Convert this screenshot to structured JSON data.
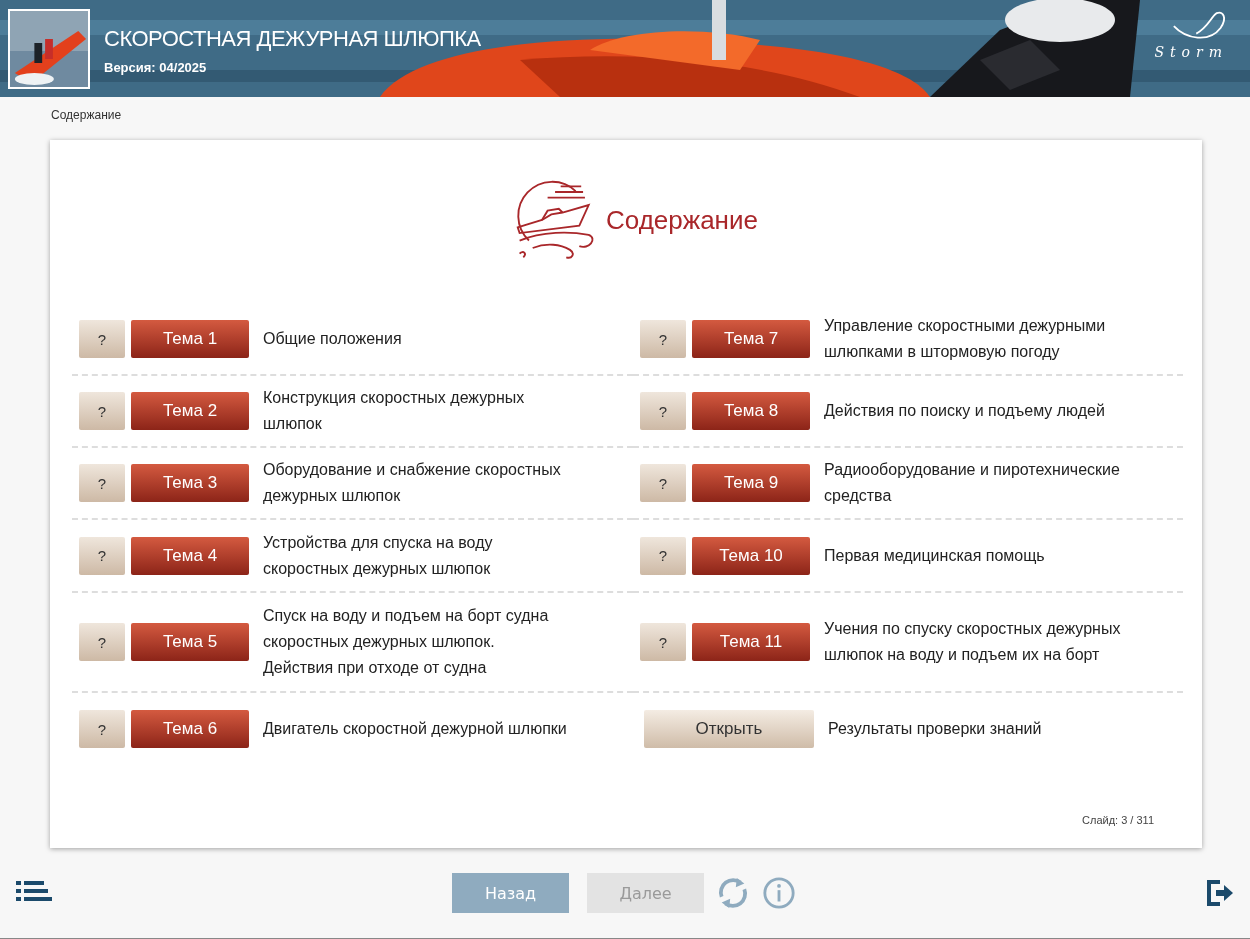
{
  "header": {
    "title": "СКОРОСТНАЯ ДЕЖУРНАЯ ШЛЮПКА",
    "version": "Версия: 04/2025",
    "logo_text": "Storm"
  },
  "breadcrumb": "Содержание",
  "content": {
    "heading": "Содержание",
    "items": [
      {
        "kind": "topic",
        "help": "?",
        "button": "Тема 1",
        "title": "Общие положения"
      },
      {
        "kind": "topic",
        "help": "?",
        "button": "Тема 2",
        "title": "Конструкция скоростных дежурных\nшлюпок"
      },
      {
        "kind": "topic",
        "help": "?",
        "button": "Тема 3",
        "title": "Оборудование и снабжение скоростных\nдежурных шлюпок"
      },
      {
        "kind": "topic",
        "help": "?",
        "button": "Тема 4",
        "title": "Устройства для спуска на воду\nскоростных дежурных шлюпок"
      },
      {
        "kind": "topic",
        "help": "?",
        "button": "Тема 5",
        "title": "Спуск на воду и подъем на борт судна\nскоростных дежурных шлюпок.\nДействия при отходе от судна"
      },
      {
        "kind": "topic",
        "help": "?",
        "button": "Тема 6",
        "title": "Двигатель скоростной дежурной шлюпки"
      },
      {
        "kind": "topic",
        "help": "?",
        "button": "Тема 7",
        "title": "Управление скоростными дежурными\nшлюпками в штормовую погоду"
      },
      {
        "kind": "topic",
        "help": "?",
        "button": "Тема 8",
        "title": "Действия по поиску и подъему людей"
      },
      {
        "kind": "topic",
        "help": "?",
        "button": "Тема 9",
        "title": "Радиооборудование и пиротехнические\nсредства"
      },
      {
        "kind": "topic",
        "help": "?",
        "button": "Тема 10",
        "title": "Первая медицинская помощь"
      },
      {
        "kind": "topic",
        "help": "?",
        "button": "Тема 11",
        "title": "Учения по спуску скоростных дежурных\nшлюпок на воду и подъем их на борт"
      },
      {
        "kind": "results",
        "button": "Открыть",
        "title": "Результаты проверки знаний"
      }
    ],
    "slide": "Слайд:  3 / 311"
  },
  "footer": {
    "back": {
      "label": "Назад",
      "disabled": false
    },
    "next": {
      "label": "Далее",
      "disabled": true
    }
  }
}
